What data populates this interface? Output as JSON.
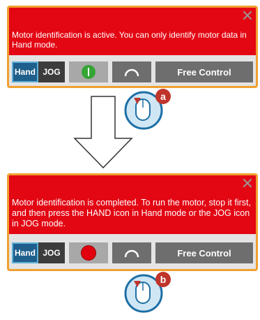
{
  "panel_a": {
    "message": "Motor identification is active. You can only identify motor data in Hand mode.",
    "hand_label": "Hand",
    "jog_label": "JOG",
    "free_control_label": "Free Control",
    "step_label": "a"
  },
  "panel_b": {
    "message": "Motor identification is completed. To run the motor, stop it first, and then press the HAND icon in Hand mode or the JOG icon in JOG mode.",
    "hand_label": "Hand",
    "jog_label": "JOG",
    "free_control_label": "Free Control",
    "step_label": "b"
  },
  "colors": {
    "message_bg": "#e30613",
    "frame": "#f0a030",
    "hand_active": "#1f5f8b",
    "running": "#35a535",
    "stopped": "#e00010",
    "callout": "#c0352b"
  },
  "icons": [
    "close-icon",
    "power-on-icon",
    "stop-icon",
    "bend-arc-icon",
    "mouse-pointer-icon",
    "down-arrow-icon"
  ]
}
